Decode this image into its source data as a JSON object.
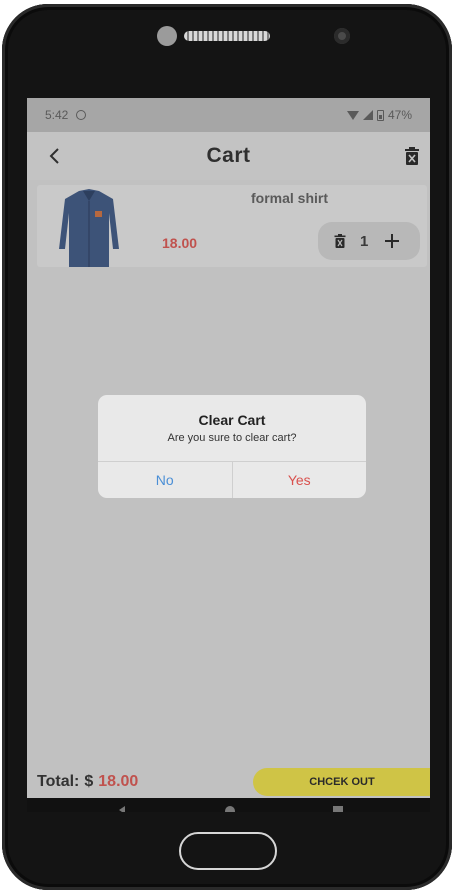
{
  "status_bar": {
    "time": "5:42",
    "battery": "47%"
  },
  "app_bar": {
    "title": "Cart"
  },
  "cart": {
    "items": [
      {
        "name": "formal shirt",
        "price": "18.00",
        "quantity": "1"
      }
    ]
  },
  "dialog": {
    "title": "Clear Cart",
    "message": "Are you sure to clear cart?",
    "no_label": "No",
    "yes_label": "Yes"
  },
  "footer": {
    "total_label": "Total:",
    "currency": "$",
    "total_value": "18.00",
    "checkout_label": "CHCEK OUT"
  },
  "colors": {
    "price": "#c0524e",
    "checkout_button": "#cfc446",
    "dialog_no": "#4b8fd6",
    "dialog_yes": "#d9514e",
    "screen_dim": "#c1c1c1"
  }
}
